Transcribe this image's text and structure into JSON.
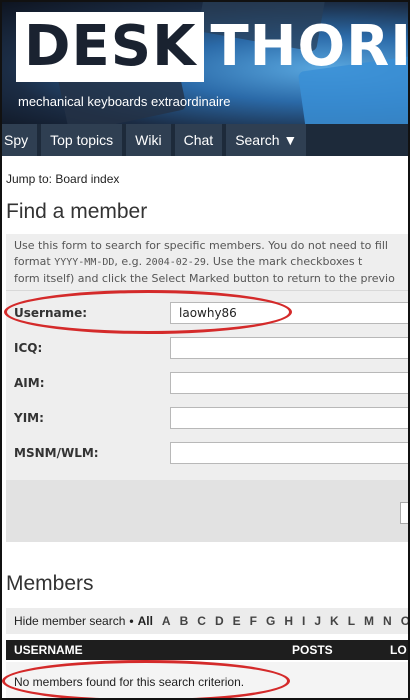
{
  "site": {
    "logo_box": "DESK",
    "logo_rest": "THORITY",
    "tagline": "mechanical keyboards extraordinaire"
  },
  "nav": {
    "tabs": [
      {
        "label": "Spy"
      },
      {
        "label": "Top topics"
      },
      {
        "label": "Wiki"
      },
      {
        "label": "Chat"
      },
      {
        "label": "Search ▼"
      }
    ]
  },
  "breadcrumb": {
    "prefix": "Jump to: ",
    "link": "Board index"
  },
  "find_member": {
    "title": "Find a member",
    "desc_line1": "Use this form to search for specific members. You do not need to fill",
    "desc_line2_a": "format ",
    "desc_line2_code1": "YYYY-MM-DD",
    "desc_line2_b": ", e.g. ",
    "desc_line2_code2": "2004-02-29",
    "desc_line2_c": ". Use the mark checkboxes t",
    "desc_line3": "form itself) and click the Select Marked button to return to the previo",
    "fields": [
      {
        "label": "Username:",
        "value": "laowhy86"
      },
      {
        "label": "ICQ:",
        "value": ""
      },
      {
        "label": "AIM:",
        "value": ""
      },
      {
        "label": "YIM:",
        "value": ""
      },
      {
        "label": "MSNM/WLM:",
        "value": ""
      }
    ]
  },
  "members": {
    "title": "Members",
    "hide_link": "Hide member search",
    "dot": "•",
    "letters": [
      "All",
      "A",
      "B",
      "C",
      "D",
      "E",
      "F",
      "G",
      "H",
      "I",
      "J",
      "K",
      "L",
      "M",
      "N",
      "O"
    ],
    "columns": {
      "username": "USERNAME",
      "posts": "POSTS",
      "location": "LO"
    },
    "no_results": "No members found for this search criterion."
  },
  "annotation_color": "#d42a2a"
}
